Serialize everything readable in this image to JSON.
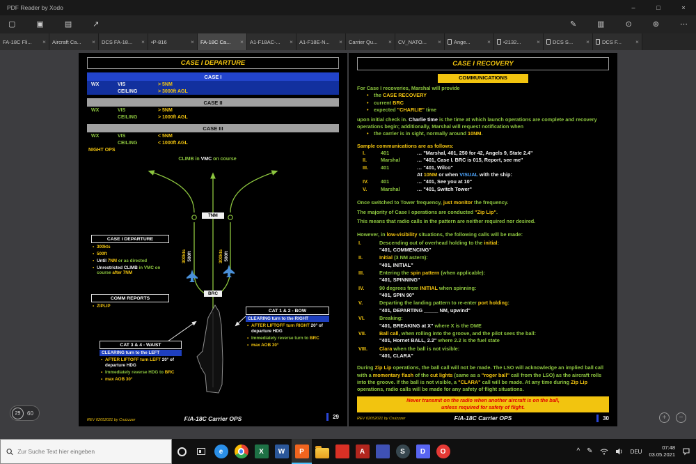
{
  "ui": {
    "bullet": "•",
    "square_bullet": "▪"
  },
  "window": {
    "title": "PDF Reader by Xodo",
    "controls": {
      "minimize": "–",
      "maximize": "□",
      "close": "×"
    }
  },
  "toolbar": {
    "left": [
      {
        "name": "open-file-icon",
        "glyph": "▢"
      },
      {
        "name": "save-icon",
        "glyph": "▣"
      },
      {
        "name": "print-icon",
        "glyph": "▤"
      },
      {
        "name": "share-icon",
        "glyph": "↗"
      }
    ],
    "right": [
      {
        "name": "edit-icon",
        "glyph": "✎"
      },
      {
        "name": "page-view-icon",
        "glyph": "▥"
      },
      {
        "name": "search-doc-icon",
        "glyph": "⊙"
      },
      {
        "name": "zoom-tool-icon",
        "glyph": "⊕"
      },
      {
        "name": "more-options-icon",
        "glyph": "⋯"
      }
    ]
  },
  "tabs": {
    "close_glyph": "×",
    "items": [
      {
        "label": "FA-18C Fli..."
      },
      {
        "label": "Aircraft Ca..."
      },
      {
        "label": "DCS FA-18..."
      },
      {
        "label": "•P-816"
      },
      {
        "label": "FA-18C Ca...",
        "active": true
      },
      {
        "label": "A1-F18AC-..."
      },
      {
        "label": "A1-F18E-N..."
      },
      {
        "label": "Carrier Qu..."
      },
      {
        "label": "CV_NATO..."
      },
      {
        "label": "Ange...",
        "icon": true
      },
      {
        "label": "•2132...",
        "icon": true
      },
      {
        "label": "DCS S...",
        "icon": true
      },
      {
        "label": "DCS F...",
        "icon": true
      }
    ]
  },
  "left_page": {
    "title": "CASE I DEPARTURE",
    "case1": {
      "header": "CASE I",
      "wx": "WX",
      "vis_label": "VIS",
      "vis": "> 5NM",
      "ceil_label": "CEILING",
      "ceil": "> 3000ft AGL"
    },
    "case2": {
      "header": "CASE II",
      "wx": "WX",
      "vis_label": "VIS",
      "vis": "> 5NM",
      "ceil_label": "CEILING",
      "ceil": "> 1000ft AGL"
    },
    "case3": {
      "header": "CASE III",
      "wx": "WX",
      "vis_label": "VIS",
      "vis": "< 5NM",
      "ceil_label": "CEILING",
      "ceil": "< 1000ft AGL",
      "note": "NIGHT OPS"
    },
    "diagram": {
      "climb": [
        {
          "t": "CLIMB in ",
          "c": "g"
        },
        {
          "t": "VMC",
          "c": "w"
        },
        {
          "t": " on course",
          "c": "g"
        }
      ],
      "range": "7NM",
      "brc": "BRC",
      "speed": "300kts",
      "alt": "500ft"
    },
    "departure_box": {
      "title": "CASE I DEPARTURE",
      "bullets": [
        [
          {
            "t": "300kts",
            "c": "y"
          }
        ],
        [
          {
            "t": "500ft",
            "c": "y"
          }
        ],
        [
          {
            "t": "Until ",
            "c": "w"
          },
          {
            "t": "7NM",
            "c": "y"
          },
          {
            "t": " or as directed",
            "c": "g"
          }
        ],
        [
          {
            "t": "Unrestricted CLIMB ",
            "c": "w"
          },
          {
            "t": "in VMC on course",
            "c": "g"
          },
          {
            "t": " after 7NM",
            "c": "y"
          }
        ]
      ]
    },
    "comm_box": {
      "title": "COMM REPORTS",
      "bullets": [
        [
          {
            "t": "ZIPLIP",
            "c": "y"
          }
        ]
      ]
    },
    "cat12_box": {
      "title": "CAT 1 & 2 - BOW",
      "clearing": [
        {
          "t": "CLEARING turn to the ",
          "c": "w"
        },
        {
          "t": "RIGHT",
          "c": "w"
        }
      ],
      "bullets": [
        [
          {
            "t": "AFTER LIFTOFF turn RIGHT",
            "c": "y"
          },
          {
            "t": " 20° of departure HDG",
            "c": "w"
          }
        ],
        [
          {
            "t": "Immediately reverse turn to ",
            "c": "g"
          },
          {
            "t": "BRC",
            "c": "y"
          }
        ],
        [
          {
            "t": "max AOB 30°",
            "c": "y"
          }
        ]
      ]
    },
    "cat34_box": {
      "title": "CAT 3 & 4 - WAIST",
      "clearing": [
        {
          "t": "CLEARING turn to the ",
          "c": "w"
        },
        {
          "t": "LEFT",
          "c": "w"
        }
      ],
      "bullets": [
        [
          {
            "t": "AFTER LIFTOFF turn LEFT",
            "c": "y"
          },
          {
            "t": " 20° of departure HDG",
            "c": "w"
          }
        ],
        [
          {
            "t": "Immediately reverse HDG to ",
            "c": "g"
          },
          {
            "t": "BRC",
            "c": "y"
          }
        ],
        [
          {
            "t": "max AOB 30°",
            "c": "y"
          }
        ]
      ]
    },
    "footer": {
      "rev": "REV 02052021 by Cruizzzer",
      "doc": "F/A-18C Carrier OPS",
      "page": "29"
    }
  },
  "right_page": {
    "title": "CASE I RECOVERY",
    "comm_header": "COMMUNICATIONS",
    "p1": [
      {
        "t": "For Case I recoveries, Marshal will provide",
        "c": "g"
      }
    ],
    "p1_bullets": [
      [
        {
          "t": "the ",
          "c": "g"
        },
        {
          "t": "CASE RECOVERY",
          "c": "y"
        }
      ],
      [
        {
          "t": "current ",
          "c": "g"
        },
        {
          "t": "BRC",
          "c": "y"
        }
      ],
      [
        {
          "t": "expected ",
          "c": "g"
        },
        {
          "t": "\"CHARLIE\"",
          "c": "y"
        },
        {
          "t": " time",
          "c": "g"
        }
      ]
    ],
    "p2": [
      {
        "t": "upon initial check in. ",
        "c": "g"
      },
      {
        "t": "Charlie time",
        "c": "w"
      },
      {
        "t": " is the time at which launch operations are complete and recovery operations begin; additionally, Marshal will request notification when",
        "c": "g"
      }
    ],
    "p2_bullet": [
      {
        "t": "the carrier is in sight, normally around ",
        "c": "g"
      },
      {
        "t": "10NM",
        "c": "y"
      },
      {
        "t": ".",
        "c": "g"
      }
    ],
    "sample_header": [
      {
        "t": "Sample communications are as follows:",
        "c": "y"
      }
    ],
    "sample_calls": [
      {
        "num": "I.",
        "who": "401",
        "text": [
          {
            "t": "… \"Marshal, 401, 250 for 42, Angels 9, State 2.4\"",
            "c": "w"
          }
        ]
      },
      {
        "num": "II.",
        "who": "Marshal",
        "text": [
          {
            "t": "… \"401, Case I. BRC is 015, Report, see me\"",
            "c": "w"
          }
        ]
      },
      {
        "num": "III.",
        "who": "401",
        "text": [
          {
            "t": "… \"401, Wilco\"",
            "c": "w"
          }
        ]
      },
      {
        "num": "",
        "who": "",
        "text": [
          {
            "t": "At ",
            "c": "w"
          },
          {
            "t": "10NM",
            "c": "y"
          },
          {
            "t": " or when ",
            "c": "w"
          },
          {
            "t": "VISUAL",
            "c": "b"
          },
          {
            "t": " with the ship:",
            "c": "w"
          }
        ]
      },
      {
        "num": "IV.",
        "who": "401",
        "text": [
          {
            "t": "… \"401, See you at 10\"",
            "c": "w"
          }
        ]
      },
      {
        "num": "V.",
        "who": "Marshal",
        "text": [
          {
            "t": "… \"401, Switch Tower\"",
            "c": "w"
          }
        ]
      }
    ],
    "p3": [
      {
        "t": "Once switched to Tower frequency, ",
        "c": "g"
      },
      {
        "t": "just monitor",
        "c": "y"
      },
      {
        "t": " the frequency.",
        "c": "g"
      }
    ],
    "p4": [
      {
        "t": "The majority of Case I operations are conducted ",
        "c": "g"
      },
      {
        "t": "\"Zip Lip\"",
        "c": "y"
      },
      {
        "t": ".",
        "c": "g"
      }
    ],
    "p5": [
      {
        "t": "This means that radio calls in the pattern are neither required nor desired.",
        "c": "g"
      }
    ],
    "p6": [
      {
        "t": "However, in ",
        "c": "g"
      },
      {
        "t": "low-visibility",
        "c": "y"
      },
      {
        "t": " situations, the following calls will be made:",
        "c": "g"
      }
    ],
    "lowvis_calls": [
      {
        "num": "I.",
        "desc": [
          {
            "t": "Descending out of overhead holding to the ",
            "c": "g"
          },
          {
            "t": "initial",
            "c": "y"
          },
          {
            "t": ":",
            "c": "g"
          }
        ],
        "call": [
          {
            "t": "\"401, COMMENCING\"",
            "c": "w"
          }
        ]
      },
      {
        "num": "II.",
        "desc": [
          {
            "t": "Initial",
            "c": "y"
          },
          {
            "t": " (3 NM astern):",
            "c": "g"
          }
        ],
        "call": [
          {
            "t": "\"401, INITIAL\"",
            "c": "w"
          }
        ]
      },
      {
        "num": "III.",
        "desc": [
          {
            "t": "Entering the ",
            "c": "g"
          },
          {
            "t": "spin pattern",
            "c": "y"
          },
          {
            "t": " (when applicable):",
            "c": "g"
          }
        ],
        "call": [
          {
            "t": "\"401, SPINNING\"",
            "c": "w"
          }
        ]
      },
      {
        "num": "IV.",
        "desc": [
          {
            "t": "90 degrees from ",
            "c": "g"
          },
          {
            "t": "INITIAL",
            "c": "y"
          },
          {
            "t": " when spinning:",
            "c": "g"
          }
        ],
        "call": [
          {
            "t": "\"401, SPIN 90\"",
            "c": "w"
          }
        ]
      },
      {
        "num": "V.",
        "desc": [
          {
            "t": "Departing the landing pattern to re-enter ",
            "c": "g"
          },
          {
            "t": "port holding",
            "c": "y"
          },
          {
            "t": ":",
            "c": "g"
          }
        ],
        "call": [
          {
            "t": "\"401, DEPARTING _____ NM, upwind\"",
            "c": "w"
          }
        ]
      },
      {
        "num": "VI.",
        "desc": [
          {
            "t": "Breaking:",
            "c": "g"
          }
        ],
        "call": [
          {
            "t": "\"401, BREAKING at X\"",
            "c": "w"
          },
          {
            "t": " where X is the DME",
            "c": "g"
          }
        ]
      },
      {
        "num": "VII.",
        "desc": [
          {
            "t": "Ball call",
            "c": "y"
          },
          {
            "t": ", when rolling into the groove, and the pilot sees the ball:",
            "c": "g"
          }
        ],
        "call": [
          {
            "t": "\"401, Hornet BALL, 2.2\"",
            "c": "w"
          },
          {
            "t": " where 2.2 is the fuel state",
            "c": "g"
          }
        ]
      },
      {
        "num": "VIII.",
        "desc": [
          {
            "t": "Clara",
            "c": "y"
          },
          {
            "t": " when the ball is not visible:",
            "c": "g"
          }
        ],
        "call": [
          {
            "t": "\"401, CLARA\"",
            "c": "w"
          }
        ]
      }
    ],
    "p7": [
      {
        "t": "During ",
        "c": "g"
      },
      {
        "t": "Zip Lip",
        "c": "y"
      },
      {
        "t": " operations, the ball call will not be made. The LSO will acknowledge an implied ball call with a ",
        "c": "g"
      },
      {
        "t": "momentary flash",
        "c": "y"
      },
      {
        "t": " of the ",
        "c": "g"
      },
      {
        "t": "cut lights",
        "c": "y"
      },
      {
        "t": " (same as a ",
        "c": "g"
      },
      {
        "t": "\"roger ball\"",
        "c": "y"
      },
      {
        "t": " call from the LSO) as the aircraft rolls into the groove. If the ball is not visible, a ",
        "c": "g"
      },
      {
        "t": "\"CLARA\"",
        "c": "y"
      },
      {
        "t": " call will be made. At any time during ",
        "c": "g"
      },
      {
        "t": "Zip Lip",
        "c": "y"
      },
      {
        "t": " operations, radio calls will be made for any safety of flight situations.",
        "c": "g"
      }
    ],
    "warning_line1": "Never transmit on the radio when another aircraft is on the ball,",
    "warning_line2": "unless required for safety of flight.",
    "footer": {
      "rev": "REV 02052021 by Cruizzzer",
      "doc": "F/A-18C Carrier OPS",
      "page": "30"
    }
  },
  "pager": {
    "current": "29",
    "total": "60"
  },
  "zoom": {
    "zoom_in": "+",
    "zoom_out": "−"
  },
  "taskbar": {
    "search_placeholder": "Zur Suche Text hier eingeben",
    "apps": [
      {
        "name": "edge-icon",
        "label": "e",
        "color": "#2a8fe8",
        "circle": true
      },
      {
        "name": "chrome-icon",
        "label": "",
        "color": "#e8e8e8",
        "chrome": true
      },
      {
        "name": "excel-icon",
        "label": "X",
        "color": "#1e7145"
      },
      {
        "name": "word-icon",
        "label": "W",
        "color": "#2b579a"
      },
      {
        "name": "xodo-pdf-icon",
        "label": "P",
        "color": "#f0641e",
        "active": true
      },
      {
        "name": "file-explorer-icon",
        "label": "",
        "color": "#f6c945",
        "folder": true
      },
      {
        "name": "photos-icon",
        "label": "",
        "color": "#d93025"
      },
      {
        "name": "acrobat-icon",
        "label": "A",
        "color": "#b3261e"
      },
      {
        "name": "app-blue-icon",
        "label": "",
        "color": "#3f51b5"
      },
      {
        "name": "steam-icon",
        "label": "S",
        "color": "#37474f",
        "circle": true
      },
      {
        "name": "discord-icon",
        "label": "D",
        "color": "#5865f2"
      },
      {
        "name": "opera-icon",
        "label": "O",
        "color": "#e53935",
        "circle": true
      }
    ],
    "tray": {
      "expand": "^",
      "pen": "✎",
      "lang": "DEU",
      "time": "07:48",
      "date": "03.05.2021"
    }
  }
}
